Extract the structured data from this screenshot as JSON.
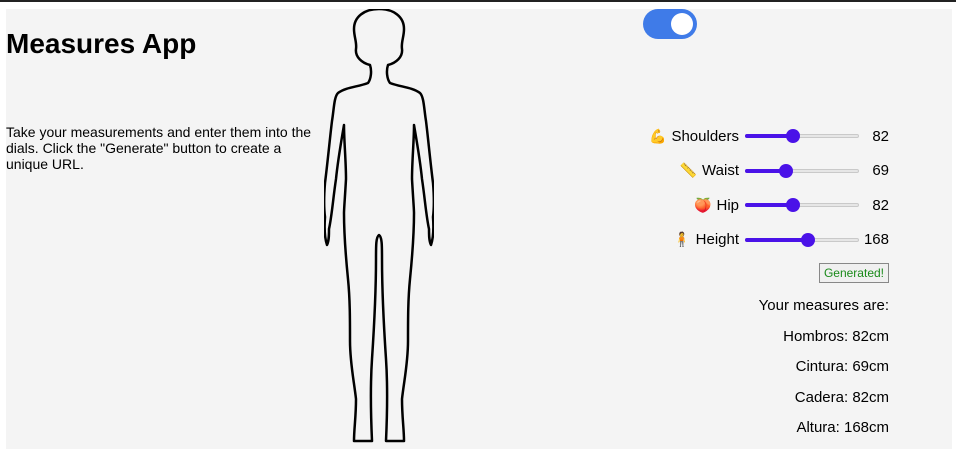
{
  "app": {
    "title": "Measures App",
    "intro": "Take your measurements and enter them into the dials. Click the \"Generate\" button to create a unique URL."
  },
  "toggle": {
    "state": "on",
    "color": "#3f7be8"
  },
  "sliders": [
    {
      "emoji": "💪",
      "label": "Shoulders",
      "value": "82",
      "fraction": 0.42
    },
    {
      "emoji": "📏",
      "label": "Waist",
      "value": "69",
      "fraction": 0.36
    },
    {
      "emoji": "🍑",
      "label": "Hip",
      "value": "82",
      "fraction": 0.42
    },
    {
      "emoji": "🧍",
      "label": "Height",
      "value": "168",
      "fraction": 0.55
    }
  ],
  "generate_button": {
    "label": "Generated!",
    "color": "#1a8a1a"
  },
  "results": {
    "heading": "Your measures are:",
    "lines": [
      "Hombros: 82cm",
      "Cintura: 69cm",
      "Cadera: 82cm",
      "Altura: 168cm"
    ]
  },
  "colors": {
    "accent": "#4a12e8",
    "panel_background": "#f4f4f4"
  }
}
